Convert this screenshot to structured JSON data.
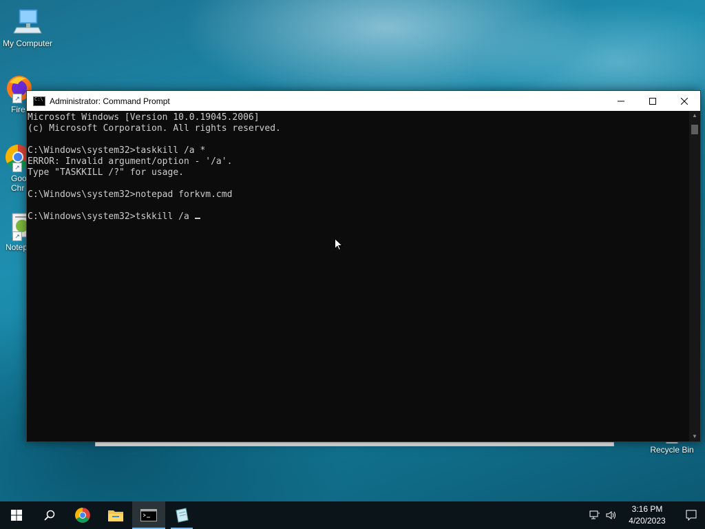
{
  "desktop": {
    "icons": [
      {
        "label": "My Computer"
      },
      {
        "label": "Fire"
      },
      {
        "label": "Goo Chr"
      },
      {
        "label": "Notep"
      },
      {
        "label": "Recycle Bin"
      }
    ]
  },
  "cmd_window": {
    "title": "Administrator: Command Prompt",
    "controls": {
      "minimize": "—",
      "maximize": "☐",
      "close": "✕"
    },
    "lines": [
      "Microsoft Windows [Version 10.0.19045.2006]",
      "(c) Microsoft Corporation. All rights reserved.",
      "",
      "C:\\Windows\\system32>taskkill /a *",
      "ERROR: Invalid argument/option - '/a'.",
      "Type \"TASKKILL /?\" for usage.",
      "",
      "C:\\Windows\\system32>notepad forkvm.cmd",
      "",
      "C:\\Windows\\system32>tskkill /a "
    ]
  },
  "taskbar": {
    "clock_time": "3:16 PM",
    "clock_date": "4/20/2023"
  },
  "colors": {
    "terminal_bg": "#0c0c0c",
    "terminal_fg": "#cccccc",
    "taskbar_bg": "#0b1419",
    "accent": "#7fb8e6"
  }
}
